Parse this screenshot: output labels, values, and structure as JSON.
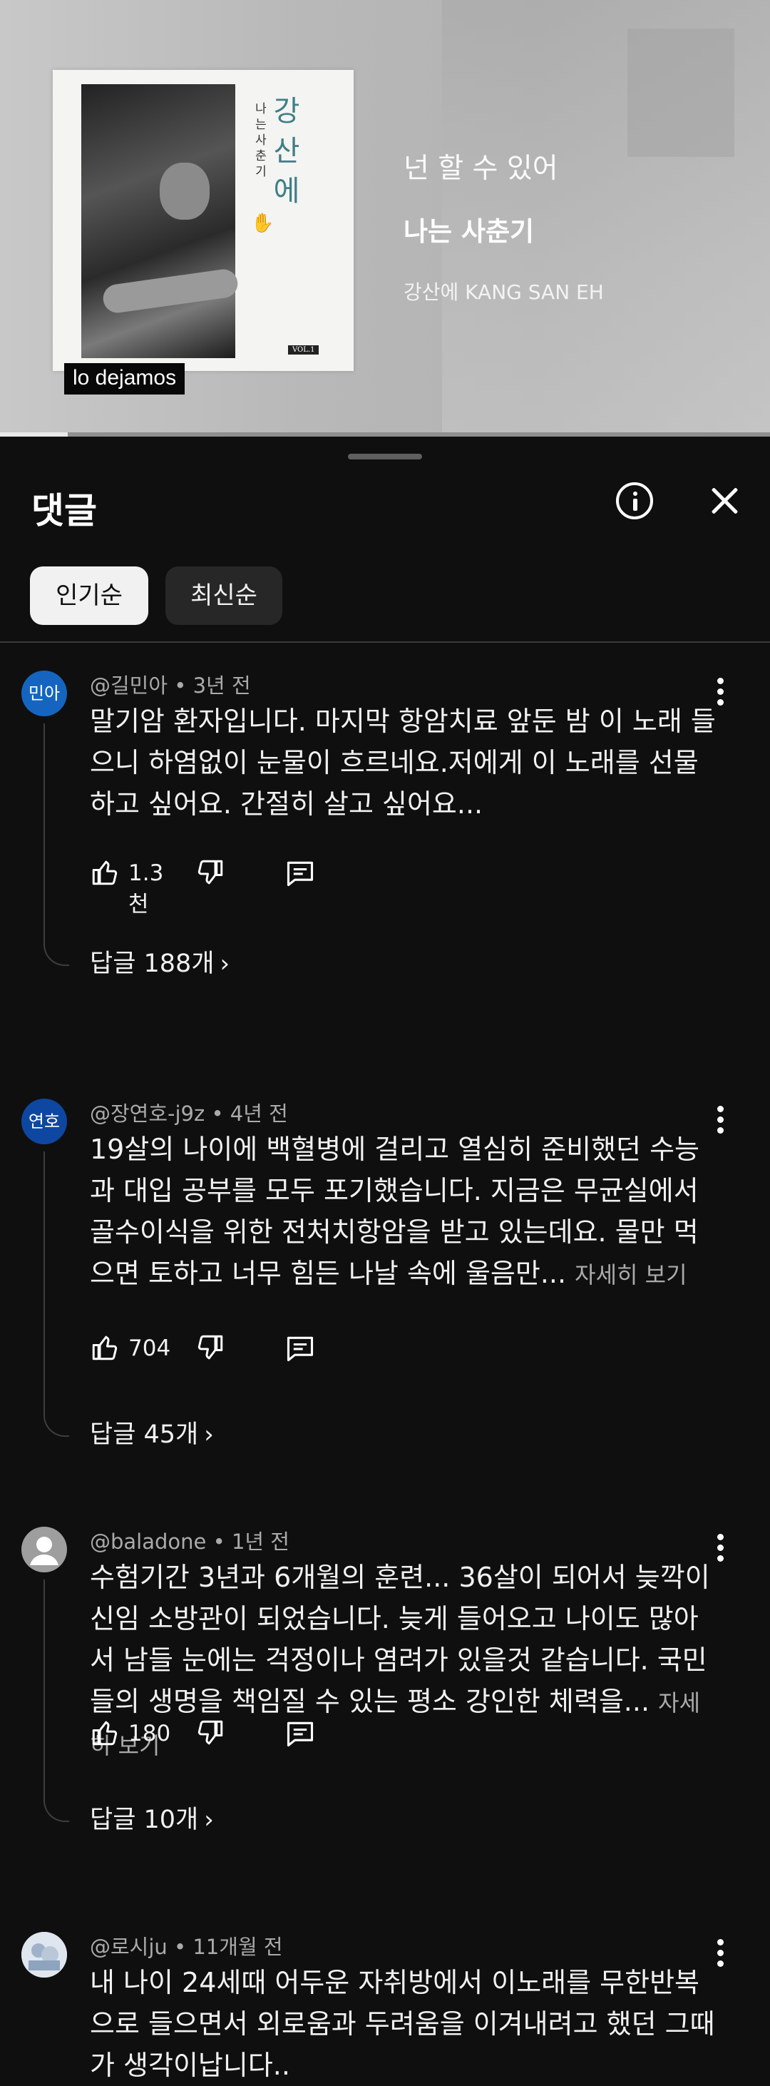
{
  "video": {
    "album_title_vertical": "강산에",
    "album_subtitle_vertical": "나는사춘기",
    "album_vol": "VOL.1",
    "caption": "lo dejamos",
    "line1": "넌 할 수 있어",
    "line2": "나는 사춘기",
    "line3": "강산에  KANG SAN EH",
    "progress": 0.088
  },
  "panel": {
    "title": "댓글",
    "sort_chips": [
      "인기순",
      "최신순"
    ]
  },
  "comments": [
    {
      "avatar_text": "민아",
      "avatar_color": "#1565c0",
      "author": "@길민아",
      "time": "3년 전",
      "body": "말기암 환자입니다. 마지막 항암치료 앞둔 밤 이 노래 들으니 하염없이 눈물이 흐르네요.저에게 이 노래를 선물하고 싶어요. 간절히 살고 싶어요...",
      "more": "",
      "likes": "1.3천",
      "replies": "답글 188개"
    },
    {
      "avatar_text": "연호",
      "avatar_color": "#0d47a1",
      "author": "@장연호-j9z",
      "time": "4년 전",
      "body": "19살의 나이에 백혈병에 걸리고 열심히 준비했던 수능과 대입 공부를 모두 포기했습니다. 지금은 무균실에서 골수이식을 위한 전처치항암을 받고 있는데요. 물만 먹으면 토하고 너무 힘든 나날 속에 울음만...",
      "more": "자세히 보기",
      "likes": "704",
      "replies": "답글 45개"
    },
    {
      "avatar_text": "",
      "avatar_color": "#9e9e9e",
      "author": "@baladone",
      "time": "1년 전",
      "body": "수험기간 3년과 6개월의 훈련... 36살이 되어서 늦깍이 신임 소방관이 되었습니다. 늦게 들어오고 나이도 많아서 남들 눈에는 걱정이나 염려가 있을것 같습니다. 국민들의 생명을 책임질 수 있는 평소 강인한 체력을...",
      "more": "자세히 보기",
      "likes": "180",
      "replies": "답글 10개"
    },
    {
      "avatar_text": "",
      "avatar_color": "#c7d3e3",
      "author": "@로시ju",
      "time": "11개월 전",
      "body": "내 나이 24세때 어두운 자취방에서   이노래를 무한반복으로 들으면서 외로움과 두려움을 이겨내려고 했던 그때가 생각이납니다..",
      "more": "",
      "likes": "",
      "replies": ""
    }
  ]
}
